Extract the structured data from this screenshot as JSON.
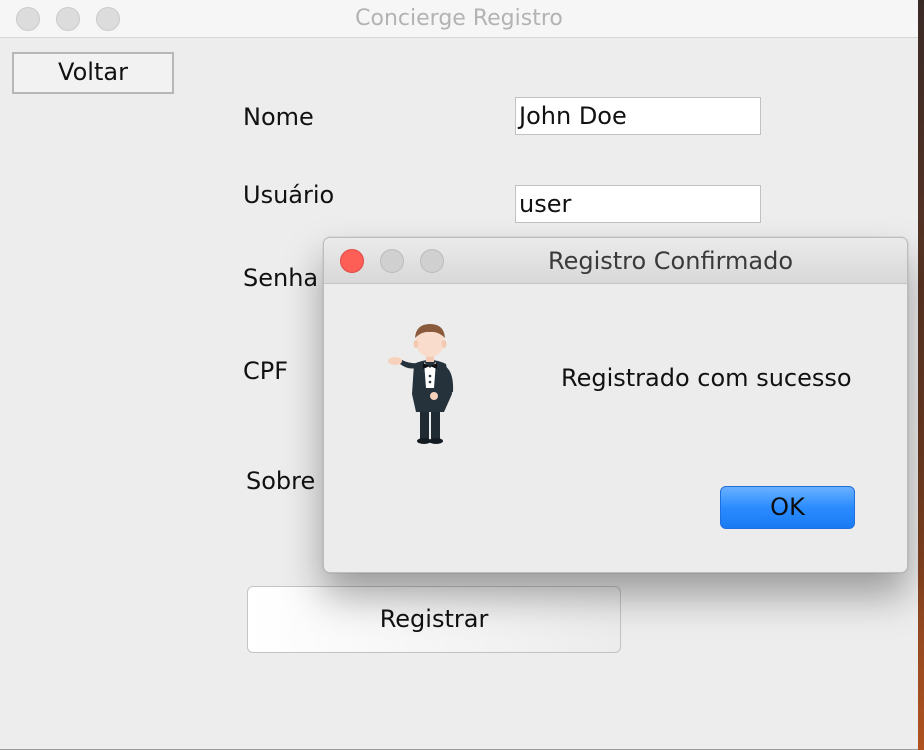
{
  "window": {
    "title": "Concierge Registro"
  },
  "toolbar": {
    "back_label": "Voltar"
  },
  "form": {
    "name_label": "Nome",
    "name_value": "John Doe",
    "user_label": "Usuário",
    "user_value": "user",
    "password_label": "Senha",
    "cpf_label": "CPF",
    "about_label": "Sobre",
    "submit_label": "Registrar"
  },
  "dialog": {
    "title": "Registro Confirmado",
    "message": "Registrado com sucesso",
    "ok_label": "OK",
    "icon": "concierge-icon"
  },
  "colors": {
    "close_button": "#fd5f57",
    "ok_button": "#2b8cff"
  }
}
